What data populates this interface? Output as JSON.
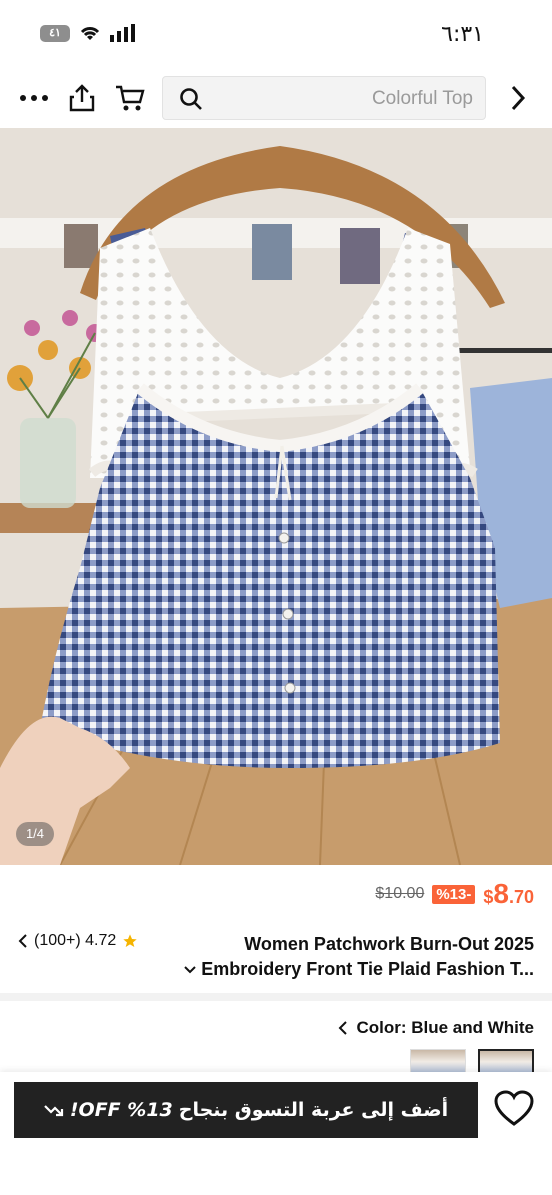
{
  "status_bar": {
    "time": "٦:٣١",
    "battery": "٤١"
  },
  "top_bar": {
    "search_placeholder": "Colorful Top"
  },
  "gallery": {
    "indicator": "1/4"
  },
  "price": {
    "original": "$10.00",
    "discount": "%13-",
    "currency": "$",
    "main": "8",
    "cents": ".70"
  },
  "product": {
    "title_line1": "Women Patchwork Burn-Out 2025",
    "title_line2": "Embroidery Front Tie Plaid Fashion T...",
    "rating": "(100+) 4.72"
  },
  "color": {
    "label": "Color: Blue and White"
  },
  "actions": {
    "add_to_cart": "أضف إلى عربة التسوق بنجاح",
    "off_text": "%13 OFF!"
  },
  "colors": {
    "accent": "#fa6338",
    "button_bg": "#222222",
    "star": "#f5b400"
  }
}
